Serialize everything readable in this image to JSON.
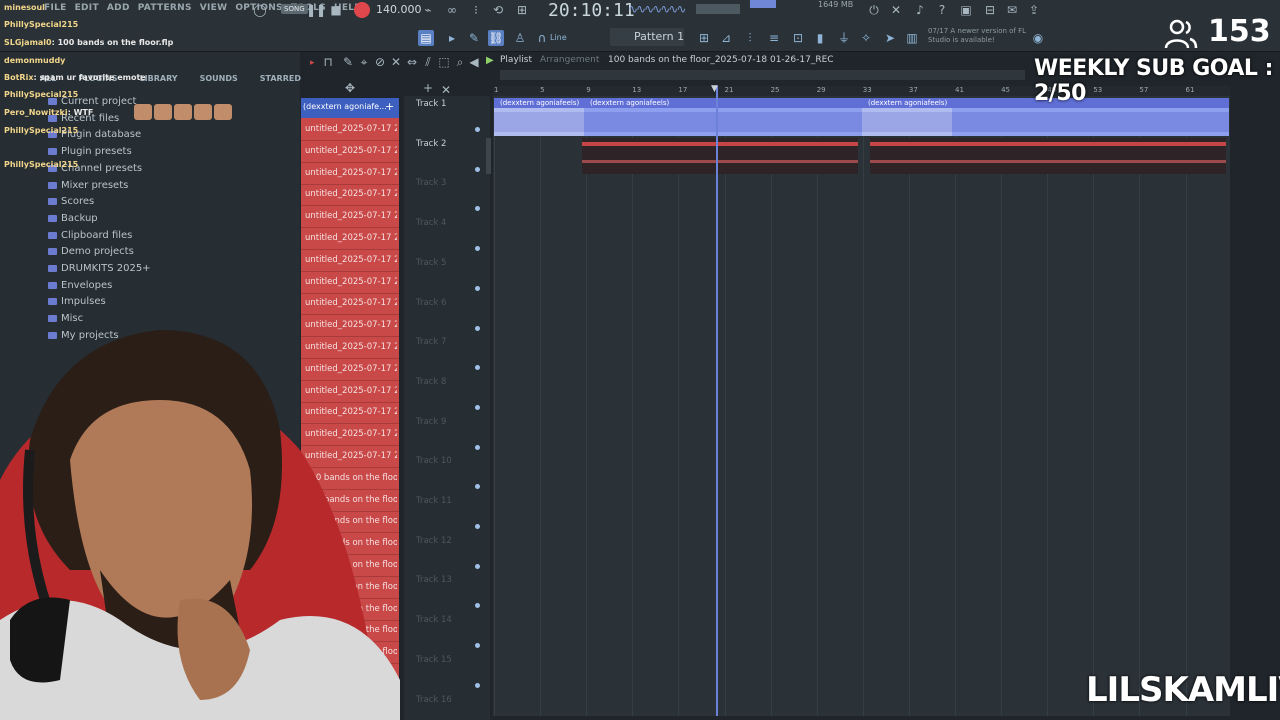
{
  "menu": [
    "FILE",
    "EDIT",
    "ADD",
    "PATTERNS",
    "VIEW",
    "OPTIONS",
    "TOOLS",
    "HELP"
  ],
  "transport": {
    "mode": "SONG",
    "tempo": "140.000",
    "time": "20:10:11",
    "memory": "1649 MB"
  },
  "pattern": {
    "label": "Pattern 1"
  },
  "snap": {
    "label": "Line"
  },
  "notice": {
    "text": "07/17 A newer version of FL Studio is available!"
  },
  "browser": {
    "tabs": [
      "ALL",
      "PLUGINS",
      "LIBRARY",
      "SOUNDS",
      "STARRED"
    ],
    "items": [
      "Current project",
      "Recent files",
      "Plugin database",
      "Plugin presets",
      "Channel presets",
      "Mixer presets",
      "Scores",
      "Backup",
      "Clipboard files",
      "Demo projects",
      "DRUMKITS 2025+",
      "Envelopes",
      "Impulses",
      "Misc",
      "My projects"
    ]
  },
  "chat": [
    {
      "user": "minesoul",
      "msg": ""
    },
    {
      "user": "PhillySpecial215",
      "msg": ""
    },
    {
      "user": "SLGjamal0",
      "msg": "100 bands on the floor.flp"
    },
    {
      "user": "demonmuddy",
      "msg": ""
    },
    {
      "user": "BotRix",
      "msg": "spam ur favorite emote"
    },
    {
      "user": "PhillySpecial215",
      "msg": ""
    },
    {
      "user": "Pero_Nowitzki",
      "msg": "WTF"
    },
    {
      "user": "PhillySpecial215",
      "msg": ""
    },
    {
      "user": "PhillySpecial215",
      "msg": ""
    }
  ],
  "playlist": {
    "title": "Playlist",
    "sub": "Arrangement",
    "project": "100 bands on the floor_2025-07-18 01-26-17_REC",
    "pattern_header": "(dexxtern  agoniafe...",
    "items": [
      "untitled_2025-07-17 23...",
      "untitled_2025-07-17 23...",
      "untitled_2025-07-17 23...",
      "untitled_2025-07-17 23...",
      "untitled_2025-07-17 23...",
      "untitled_2025-07-17 23...",
      "untitled_2025-07-17 23...",
      "untitled_2025-07-17 23...",
      "untitled_2025-07-17 23...",
      "untitled_2025-07-17 23...",
      "untitled_2025-07-17 23...",
      "untitled_2025-07-17 23...",
      "untitled_2025-07-17 23...",
      "untitled_2025-07-17 23...",
      "untitled_2025-07-17 23...",
      "untitled_2025-07-17 23...",
      "100 bands on the floor_...",
      "100 bands on the floor_...",
      "100 bands on the floor_...",
      "100 bands on the floor_...",
      "100 bands on the floor_...",
      "100 bands on the floor_...",
      "100 bands on the floor_...",
      "100 bands on the floor_...",
      "100 bands on the floor_..."
    ]
  },
  "tracks": [
    "Track 1",
    "Track 2",
    "Track 3",
    "Track 4",
    "Track 5",
    "Track 6",
    "Track 7",
    "Track 8",
    "Track 9",
    "Track 10",
    "Track 11",
    "Track 12",
    "Track 13",
    "Track 14",
    "Track 15",
    "Track 16"
  ],
  "ruler": [
    "1",
    "5",
    "9",
    "13",
    "17",
    "21",
    "25",
    "29",
    "33",
    "37",
    "41",
    "45",
    "49",
    "53",
    "57",
    "61"
  ],
  "clips": {
    "track1": "(dexxtern  agoniafeels)",
    "track1b": "(dexxtern  agoniafeels)",
    "track1c": "(dexxtern  agoniafeels)"
  },
  "overlay": {
    "viewers": "153",
    "sub_goal": "WEEKLY SUB GOAL : 2/50",
    "brand": "LILSKAMLIVE"
  },
  "colors": {
    "accent": "#5a7fc2",
    "clip": "#8f9ff0",
    "pattern_list": "#c94848"
  }
}
